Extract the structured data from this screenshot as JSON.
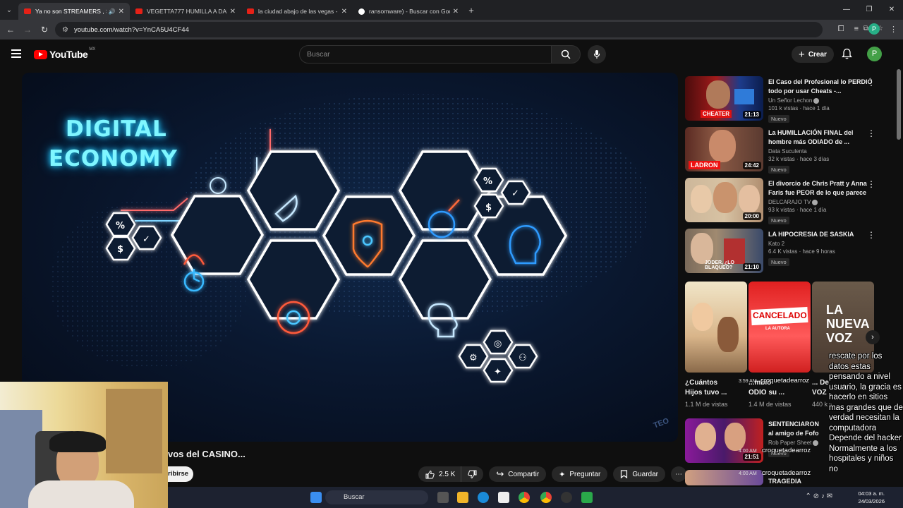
{
  "browser": {
    "tabs": [
      {
        "title": "Ya no son STREAMERS , So",
        "active": true
      },
      {
        "title": "VEGETTA777 HUMILLA A DALA",
        "active": false
      },
      {
        "title": "la ciudad abajo de las vegas - Y",
        "active": false
      },
      {
        "title": "ransomware) - Buscar con Goo",
        "active": false
      }
    ],
    "url": "youtube.com/watch?v=YnCA5U4CF44",
    "profile_initial": "P"
  },
  "header": {
    "logo": "YouTube",
    "country": "MX",
    "search_placeholder": "Buscar",
    "create_label": "Crear",
    "avatar_initial": "P"
  },
  "video": {
    "thumb_title_1": "DIGITAL",
    "thumb_title_2": "ECONOMY",
    "watermark": "TEO",
    "title": "vos del CASINO...",
    "subscribe_label": "ribirse",
    "likes": "2.5 K",
    "share_label": "Compartir",
    "ask_label": "Preguntar",
    "save_label": "Guardar"
  },
  "recommendations": [
    {
      "title": "El Caso del Profesional lo PERDIÓ todo por usar Cheats -...",
      "channel": "Un Señor Lechon",
      "verified": true,
      "meta": "101 k vistas · hace 1 día",
      "badge": "Nuevo",
      "duration": "21:13",
      "thumb_label": "CHEATER"
    },
    {
      "title": "La HUMILLACIÓN FINAL del hombre más ODIADO de ...",
      "channel": "Data Suculenta",
      "verified": false,
      "meta": "32 k vistas · hace 3 días",
      "badge": "Nuevo",
      "duration": "24:42",
      "thumb_label": "LADRON"
    },
    {
      "title": "El divorcio de Chris Pratt y Anna Faris fue PEOR de lo que parece",
      "channel": "DELCARAJO TV",
      "verified": true,
      "meta": "93 k vistas · hace 1 día",
      "badge": "Nuevo",
      "duration": "20:00",
      "thumb_label": ""
    },
    {
      "title": "LA HIPOCRESIA DE SASKIA",
      "channel": "Kato 2",
      "verified": false,
      "meta": "6.4 K vistas · hace 9 horas",
      "badge": "Nuevo",
      "duration": "21:10",
      "thumb_label": "JODER, ¿LO BLAQUEO?"
    },
    {
      "title": "SENTENCIARON al amigo de Fofo Márquez...",
      "channel": "Rob Paper Sheet",
      "verified": true,
      "meta": "",
      "badge": "Nuevo",
      "duration": "21:51",
      "thumb_label": ""
    },
    {
      "title": "TRAGEDIA",
      "channel": "",
      "verified": false,
      "meta": "",
      "badge": "",
      "duration": "",
      "thumb_label": ""
    }
  ],
  "shorts": [
    {
      "title": "¿Cuántos Hijos tuvo ...",
      "views": "1.1 M de vistas"
    },
    {
      "title": "...mbió ODIO su ...",
      "views": "1.4 M de vistas",
      "thumb_label": "CANCELADO",
      "sub_label": "LA AUTORA"
    },
    {
      "title": "... De VOZ En ...",
      "views": "440 k vistas",
      "thumb_label": "LA NUEVA VOZ"
    }
  ],
  "chat": {
    "message": "rescate por los datos estas pensando a nivel usuario, la gracia es hacerlo en sitios mas grandes que de verdad necesitan la computadora Depende del hacker Normalmente a los hospitales y niños no",
    "users": [
      "croquetadearroz",
      "croquetadearroz",
      "croquetadearroz",
      "croquetadearroz"
    ],
    "times": [
      "3:59 AM",
      "4:00 AM",
      "4:00 AM"
    ]
  },
  "taskbar": {
    "search_label": "Buscar",
    "time": "04:03 a. m.",
    "date": "24/03/2026"
  },
  "colors": {
    "background": "#0f0f0f",
    "accent_red": "#ff0000",
    "neon_cyan": "#7ff6ff",
    "neon_orange": "#ff7a2e"
  }
}
